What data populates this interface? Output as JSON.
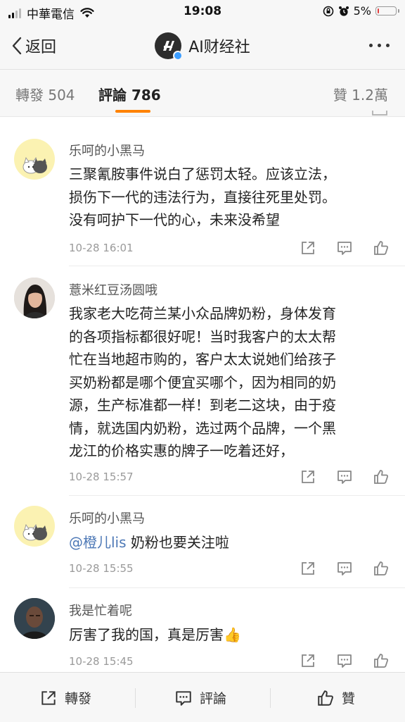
{
  "status_bar": {
    "carrier": "中華電信",
    "time": "19:08",
    "battery": "5%",
    "battery_level": 0.05
  },
  "nav": {
    "back_label": "返回",
    "title": "AI财经社"
  },
  "tabs": {
    "repost": "轉發 504",
    "comments": "評論 786",
    "likes": "贊 1.2萬"
  },
  "comments": [
    {
      "author": "乐呵的小黑马",
      "lines": [
        "三聚氰胺事件说白了惩罚太轻。应该立法，",
        "损伤下一代的违法行为，直接往死里处罚。",
        "没有呵护下一代的心，未来没希望"
      ],
      "time": "10-28 16:01"
    },
    {
      "author": "薏米红豆汤圆哦",
      "lines": [
        "我家老大吃荷兰某小众品牌奶粉，身体发育",
        "的各项指标都很好呢！当时我客户的太太帮",
        "忙在当地超市购的，客户太太说她们给孩子",
        "买奶粉都是哪个便宜买哪个，因为相同的奶",
        "源，生产标准都一样！到老二这块，由于疫",
        "情，就选国内奶粉，选过两个品牌，一个黑",
        "龙江的价格实惠的牌子一吃着还好，"
      ],
      "time": "10-28 15:57"
    },
    {
      "author": "乐呵的小黑马",
      "mention": "@橙儿lis",
      "text": " 奶粉也要关注啦",
      "time": "10-28 15:55"
    },
    {
      "author": "我是忙着呢",
      "text": "厉害了我的国，真是厉害",
      "emoji": "👍",
      "time": "10-28 15:45"
    }
  ],
  "bottom_bar": {
    "repost": "轉發",
    "comment": "評論",
    "like": "贊"
  },
  "colors": {
    "accent": "#ff8200",
    "mention": "#4d78b6",
    "verified": "#3b9dff"
  }
}
